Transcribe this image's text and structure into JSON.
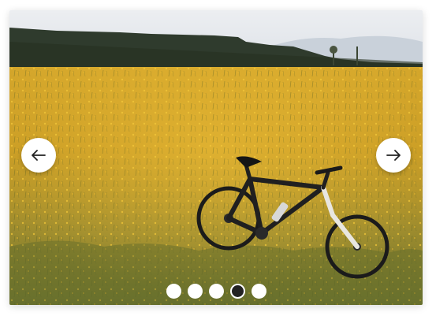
{
  "carousel": {
    "slide_count": 5,
    "active_index": 3,
    "slide_image": "bicycle-in-yellow-flower-field",
    "prev_icon": "arrow-left-icon",
    "next_icon": "arrow-right-icon"
  },
  "colors": {
    "field_yellow": "#c9a227",
    "sky": "#e9ebee",
    "forest": "#2b3a2a",
    "button_bg": "#ffffff",
    "dot_active": "#222222"
  }
}
